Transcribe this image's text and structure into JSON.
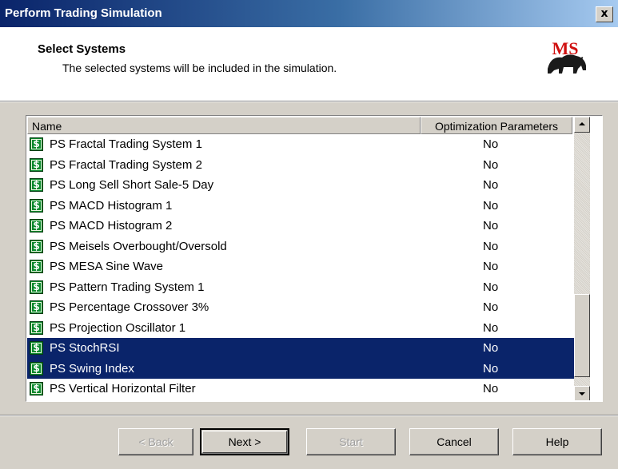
{
  "window": {
    "title": "Perform Trading Simulation",
    "close_label": "x"
  },
  "header": {
    "title": "Select Systems",
    "subtitle": "The selected systems will be included in the simulation.",
    "logo_text": "MS"
  },
  "list": {
    "columns": {
      "name": "Name",
      "optimization": "Optimization Parameters"
    },
    "rows": [
      {
        "name": "PS Fractal Trading System 1",
        "opt": "No",
        "selected": false
      },
      {
        "name": "PS Fractal Trading System 2",
        "opt": "No",
        "selected": false
      },
      {
        "name": "PS Long Sell Short Sale-5 Day",
        "opt": "No",
        "selected": false
      },
      {
        "name": "PS MACD Histogram 1",
        "opt": "No",
        "selected": false
      },
      {
        "name": "PS MACD Histogram 2",
        "opt": "No",
        "selected": false
      },
      {
        "name": "PS Meisels Overbought/Oversold",
        "opt": "No",
        "selected": false
      },
      {
        "name": "PS MESA Sine Wave",
        "opt": "No",
        "selected": false
      },
      {
        "name": "PS Pattern Trading System 1",
        "opt": "No",
        "selected": false
      },
      {
        "name": "PS Percentage Crossover 3%",
        "opt": "No",
        "selected": false
      },
      {
        "name": "PS Projection Oscillator 1",
        "opt": "No",
        "selected": false
      },
      {
        "name": "PS StochRSI",
        "opt": "No",
        "selected": true
      },
      {
        "name": "PS Swing Index",
        "opt": "No",
        "selected": true
      },
      {
        "name": "PS Vertical Horizontal Filter",
        "opt": "No",
        "selected": false
      }
    ],
    "row_icon": "dollar-icon",
    "selection_color": "#0a246a"
  },
  "buttons": {
    "back": "< Back",
    "next": "Next >",
    "start": "Start",
    "cancel": "Cancel",
    "help": "Help"
  },
  "colors": {
    "title_gradient_start": "#0a246a",
    "title_gradient_end": "#a6caf0",
    "face": "#d4d0c8",
    "icon_green": "#0c8a2e"
  }
}
